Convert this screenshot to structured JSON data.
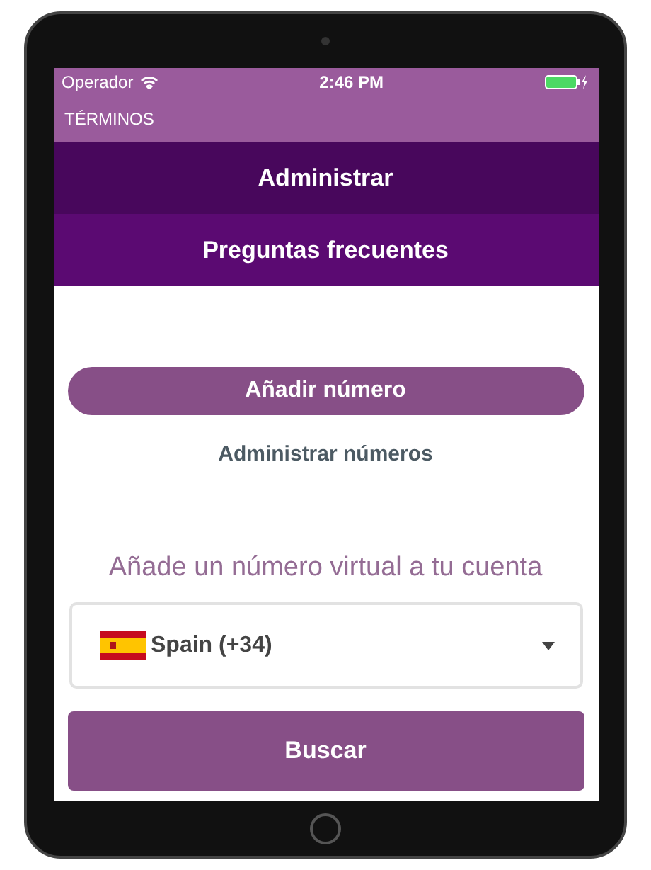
{
  "status_bar": {
    "carrier": "Operador",
    "time": "2:46 PM"
  },
  "nav_bar": {
    "link": "TÉRMINOS"
  },
  "menu": [
    {
      "label": "Administrar",
      "selected": true
    },
    {
      "label": "Preguntas frecuentes",
      "selected": false
    }
  ],
  "add_button": "Añadir número",
  "manage_link": "Administrar números",
  "heading": "Añade un número virtual a tu cuenta",
  "country_select": {
    "value": "Spain (+34)"
  },
  "search_button": "Buscar"
}
